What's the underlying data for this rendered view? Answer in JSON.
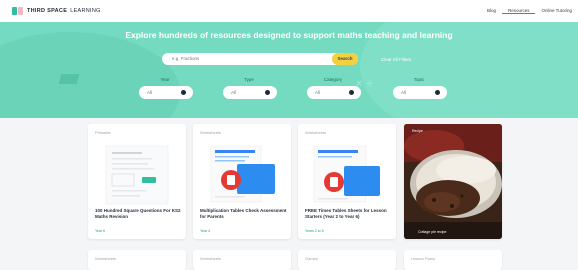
{
  "header": {
    "logo_bold": "THIRD SPACE",
    "logo_light": "LEARNING",
    "nav": [
      "Blog",
      "Resources",
      "Online Tutoring"
    ]
  },
  "hero": {
    "heading": "Explore hundreds of resources designed to support maths teaching and learning",
    "search_placeholder": "e.g. Fractions",
    "search_button": "Search",
    "clear_label": "Clear All Filters",
    "filters": [
      {
        "label": "Year",
        "value": "All"
      },
      {
        "label": "Type",
        "value": "All"
      },
      {
        "label": "Category",
        "value": "All"
      },
      {
        "label": "Topic",
        "value": "All"
      }
    ]
  },
  "cards": [
    {
      "tag": "Printable",
      "title": "100 Hundred Square Questions For KS2 Maths Revision",
      "meta": "Year 6"
    },
    {
      "tag": "Worksheets",
      "title": "Multiplication Tables Check Assessment for Parents",
      "meta": "Year 4"
    },
    {
      "tag": "Worksheets",
      "title": "FREE Times Tables Sheets for Lesson Starters (Year 2 to Year 6)",
      "meta": "Years 2 to 6"
    },
    {
      "tag": "Recipe",
      "caption": "Cottage pie recipe"
    }
  ],
  "row2_tags": [
    "Worksheets",
    "Worksheets",
    "Games",
    "Lesson Plans"
  ],
  "colors": {
    "accent": "#1f9f83",
    "hero": "#74dbc0",
    "search_button": "#f4d03f",
    "red_badge": "#e53935"
  }
}
